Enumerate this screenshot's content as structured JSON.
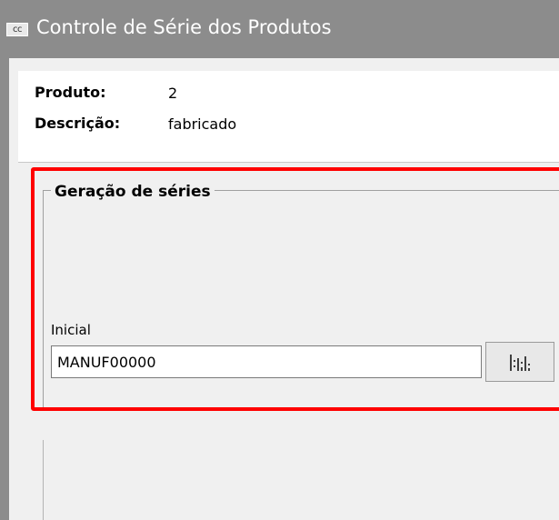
{
  "window": {
    "title": "Controle de Série dos Produtos",
    "icon_text": "cc"
  },
  "product": {
    "produto_label": "Produto:",
    "produto_value": "2",
    "descricao_label": "Descrição:",
    "descricao_value": "fabricado"
  },
  "generation": {
    "group_title": "Geração de séries",
    "inicial_label": "Inicial",
    "inicial_value": "MANUF00000",
    "button_icon": "barcode-icon"
  },
  "colors": {
    "titlebar": "#8c8c8c",
    "highlight": "#ff0000",
    "panel_bg": "#f0f0f0"
  }
}
